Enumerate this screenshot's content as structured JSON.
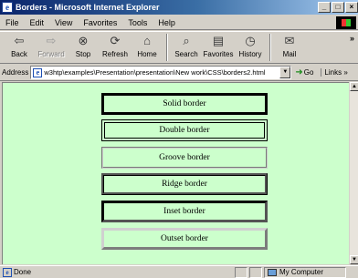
{
  "window": {
    "title": "Borders - Microsoft Internet Explorer",
    "buttons": [
      "_",
      "□",
      "×"
    ]
  },
  "menu": {
    "items": [
      {
        "label": "File"
      },
      {
        "label": "Edit"
      },
      {
        "label": "View"
      },
      {
        "label": "Favorites"
      },
      {
        "label": "Tools"
      },
      {
        "label": "Help"
      }
    ]
  },
  "toolbar": {
    "back": "Back",
    "forward": "Forward",
    "stop": "Stop",
    "refresh": "Refresh",
    "home": "Home",
    "search": "Search",
    "favorites": "Favorites",
    "history": "History",
    "mail": "Mail",
    "more": "»"
  },
  "address": {
    "label": "Address",
    "url": "w3htp\\examples\\Presentation\\presentation\\New work\\CSS\\borders2.html",
    "go": "Go",
    "links": "Links »"
  },
  "page": {
    "background": "#ccffcc",
    "boxes": [
      {
        "label": "Solid border"
      },
      {
        "label": "Double border"
      },
      {
        "label": "Groove border"
      },
      {
        "label": "Ridge border"
      },
      {
        "label": "Inset border"
      },
      {
        "label": "Outset border"
      }
    ]
  },
  "status": {
    "text": "Done",
    "zone": "My Computer"
  }
}
